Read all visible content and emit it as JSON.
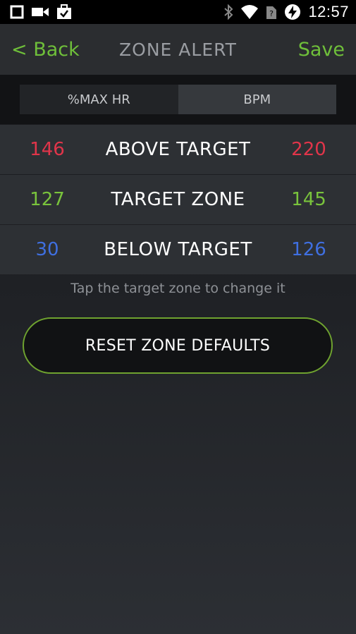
{
  "status_bar": {
    "time": "12:57",
    "left_icons": [
      "square-icon",
      "video-camera-icon",
      "briefcase-check-icon"
    ],
    "right_icons": [
      "bluetooth-icon",
      "wifi-icon",
      "no-sim-icon",
      "battery-charging-icon"
    ]
  },
  "header": {
    "back_label": "< Back",
    "title": "ZONE ALERT",
    "save_label": "Save"
  },
  "unit_toggle": {
    "options": [
      "%MAX HR",
      "BPM"
    ],
    "selected": "%MAX HR"
  },
  "zones": [
    {
      "min": "146",
      "label": "ABOVE TARGET",
      "max": "220",
      "color": "#e0354a"
    },
    {
      "min": "127",
      "label": "TARGET ZONE",
      "max": "145",
      "color": "#79c33c"
    },
    {
      "min": "30",
      "label": "BELOW TARGET",
      "max": "126",
      "color": "#3f6fe0"
    }
  ],
  "hint_text": "Tap the target zone to change it",
  "reset_button_label": "RESET ZONE DEFAULTS",
  "colors": {
    "accent_green": "#6fbf3a",
    "above": "#e0354a",
    "target": "#79c33c",
    "below": "#3f6fe0"
  }
}
